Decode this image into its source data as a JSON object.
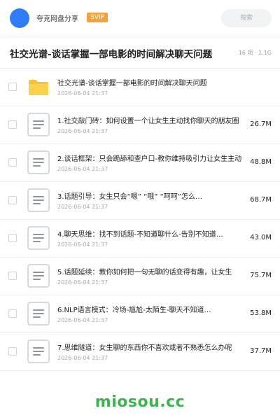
{
  "header": {
    "app_name": "夸克网盘分享",
    "badge": "SVIP",
    "search_placeholder": "搜索"
  },
  "folder_title": "社交光谱-谈话掌握一部电影的时间解决聊天问题",
  "meta": "16 项 · 1.1G",
  "colors": {
    "accent": "#2f7cf6",
    "badge": "#f3a23c",
    "brand": "#3fb34f",
    "folder": "#f6c23a"
  },
  "items": [
    {
      "type": "folder",
      "icon": "folder-icon",
      "name": "社交光谱-谈话掌握一部电影的时间解决聊天问题",
      "date": "2026-06-04 21:37",
      "size": ""
    },
    {
      "type": "file",
      "icon": "document-icon",
      "name": "1.社交敲门砖：如何设置一个让女生主动找你聊天的朋友圈",
      "date": "2026-06-04 21:37",
      "size": "26.7M"
    },
    {
      "type": "file",
      "icon": "document-icon",
      "name": "2.谈话框架：只会跪舔和查户口-教你维持吸引力让女生主动",
      "date": "2026-06-04 21:37",
      "size": "48.8M"
    },
    {
      "type": "file",
      "icon": "document-icon",
      "name": "3.话题引导：女生只会“嗯” “哦” “呵呵”怎么…",
      "date": "2026-06-04 21:37",
      "size": "68.7M"
    },
    {
      "type": "file",
      "icon": "document-icon",
      "name": "4.聊天思维：找不到话题-不知道聊什么-告别不知道…",
      "date": "2026-06-04 21:37",
      "size": "43.0M"
    },
    {
      "type": "file",
      "icon": "document-icon",
      "name": "5.话题延续：教你如何把一句无聊的话变得有趣，让女生",
      "date": "2026-06-04 21:37",
      "size": "75.7M"
    },
    {
      "type": "file",
      "icon": "document-icon",
      "name": "6.NLP语言模式：冷场-尴尬-太陌生-聊天不知道…",
      "date": "2026-06-04 21:37",
      "size": "53.8M"
    },
    {
      "type": "file",
      "icon": "document-icon",
      "name": "7.思维隧道：女生聊的东西你不喜欢或者不熟悉怎么办呢",
      "date": "2026-06-04 21:37",
      "size": "37.7M"
    }
  ],
  "footer": {
    "brand": "miosou.cc"
  }
}
